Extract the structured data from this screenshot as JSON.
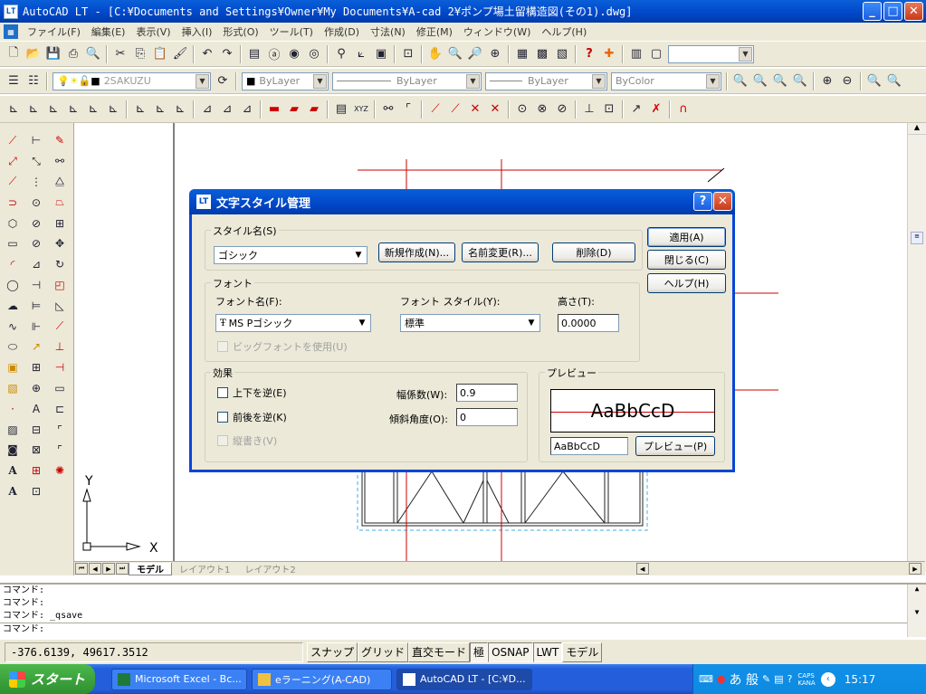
{
  "window": {
    "app_icon": "LT",
    "title": "AutoCAD LT - [C:¥Documents and Settings¥Owner¥My Documents¥A-cad 2¥ポンプ場土留構造図(その1).dwg]"
  },
  "menu": [
    "ファイル(F)",
    "編集(E)",
    "表示(V)",
    "挿入(I)",
    "形式(O)",
    "ツール(T)",
    "作成(D)",
    "寸法(N)",
    "修正(M)",
    "ウィンドウ(W)",
    "ヘルプ(H)"
  ],
  "toolbar2": {
    "layer": "2SAKUZU",
    "color": "ByLayer",
    "linetype": "ByLayer",
    "lineweight": "ByLayer",
    "plotstyle": "ByColor"
  },
  "canvas": {
    "axis_y": "Y",
    "axis_x": "X"
  },
  "tabs": [
    "モデル",
    "レイアウト1",
    "レイアウト2"
  ],
  "command_lines": [
    "コマンド:",
    "コマンド:",
    "コマンド: _qsave",
    "コマンド:"
  ],
  "status": {
    "coords": "-376.6139,  49617.3512",
    "buttons": [
      {
        "label": "スナップ",
        "on": false
      },
      {
        "label": "グリッド",
        "on": false
      },
      {
        "label": "直交モード",
        "on": false
      },
      {
        "label": "極",
        "on": true
      },
      {
        "label": "OSNAP",
        "on": true
      },
      {
        "label": "LWT",
        "on": true
      },
      {
        "label": "モデル",
        "on": false
      }
    ]
  },
  "taskbar": {
    "start": "スタート",
    "tasks": [
      {
        "label": "Microsoft Excel - Bc...",
        "active": false
      },
      {
        "label": "eラーニング(A-CAD)",
        "active": false
      },
      {
        "label": "AutoCAD LT - [C:¥D...",
        "active": true
      }
    ],
    "ime": "あ 般",
    "caps": "CAPS",
    "kana": "KANA",
    "clock": "15:17"
  },
  "dialog": {
    "title": "文字スタイル管理",
    "style_group": "スタイル名(S)",
    "style_value": "ゴシック",
    "new_button": "新規作成(N)...",
    "rename_button": "名前変更(R)...",
    "delete_button": "削除(D)",
    "apply_button": "適用(A)",
    "close_button": "閉じる(C)",
    "help_button": "ヘルプ(H)",
    "font_group": "フォント",
    "font_name_label": "フォント名(F):",
    "font_name_value": "MS Pゴシック",
    "font_style_label": "フォント スタイル(Y):",
    "font_style_value": "標準",
    "height_label": "高さ(T):",
    "height_value": "0.0000",
    "bigfont_label": "ビッグフォントを使用(U)",
    "effects_group": "効果",
    "upside_down": "上下を逆(E)",
    "backwards": "前後を逆(K)",
    "vertical": "縦書き(V)",
    "width_label": "幅係数(W):",
    "width_value": "0.9",
    "oblique_label": "傾斜角度(O):",
    "oblique_value": "0",
    "preview_group": "プレビュー",
    "preview_text": "AaBbCcD",
    "preview_input": "AaBbCcD",
    "preview_button": "プレビュー(P)"
  }
}
